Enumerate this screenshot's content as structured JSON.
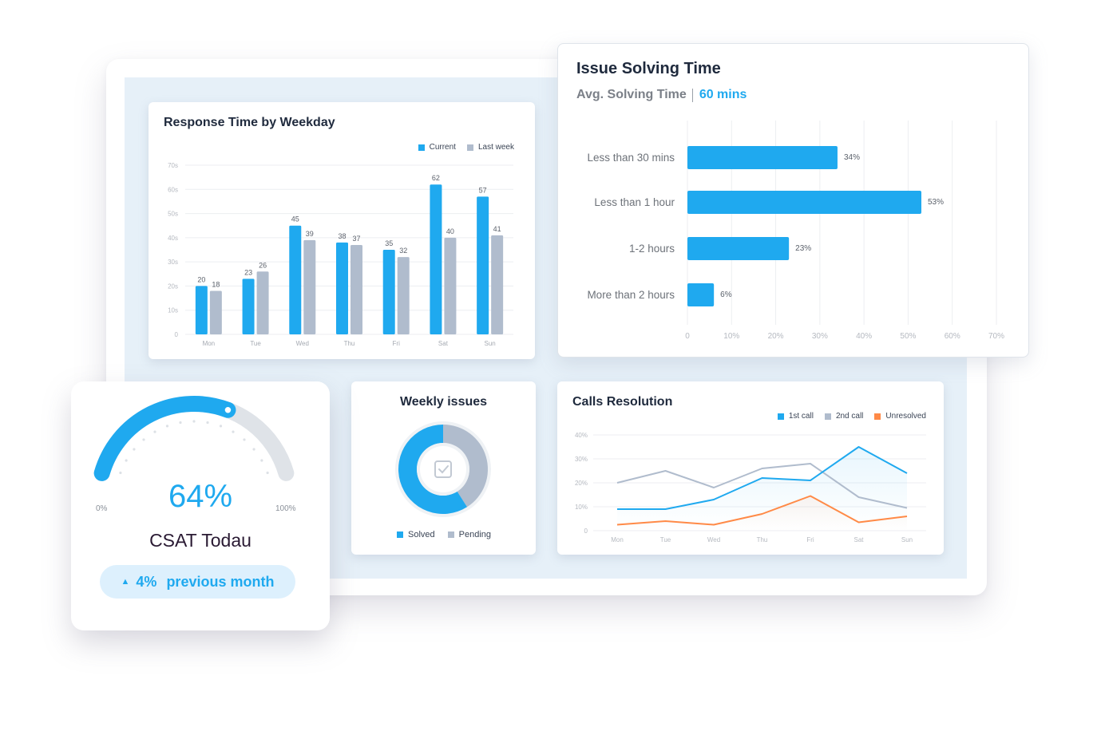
{
  "colors": {
    "primary": "#1fa9ef",
    "secondary": "#b0bccd",
    "accent": "#ff8a47",
    "track": "#dfe3e8",
    "panel_bg": "#e6f0f8"
  },
  "response_card": {
    "title": "Response Time by Weekday",
    "legend": [
      "Current",
      "Last week"
    ]
  },
  "issue_card": {
    "title": "Issue Solving Time",
    "avg_label": "Avg. Solving Time",
    "avg_value": "60 mins"
  },
  "csat_card": {
    "value_label": "64%",
    "value": 64,
    "min_label": "0%",
    "max_label": "100%",
    "title": "CSAT Todau",
    "trend_arrow": "▲",
    "trend_value": "4%",
    "trend_label": "previous month"
  },
  "weekly_card": {
    "title": "Weekly issues",
    "legend": [
      "Solved",
      "Pending"
    ],
    "center_icon": "checkbox-icon"
  },
  "calls_card": {
    "title": "Calls Resolution",
    "legend": [
      "1st call",
      "2nd call",
      "Unresolved"
    ]
  },
  "chart_data": [
    {
      "id": "response",
      "type": "bar",
      "title": "Response Time by Weekday",
      "xlabel": "",
      "ylabel": "",
      "categories": [
        "Mon",
        "Tue",
        "Wed",
        "Thu",
        "Fri",
        "Sat",
        "Sun"
      ],
      "series": [
        {
          "name": "Current",
          "values": [
            20,
            23,
            45,
            38,
            35,
            62,
            57
          ]
        },
        {
          "name": "Last week",
          "values": [
            18,
            26,
            39,
            37,
            32,
            40,
            41
          ]
        }
      ],
      "yticks": [
        "0",
        "10s",
        "20s",
        "30s",
        "40s",
        "50s",
        "60s",
        "70s"
      ],
      "ylim": [
        0,
        70
      ],
      "grid": true,
      "legend_position": "top-right",
      "data_labels": true
    },
    {
      "id": "issue",
      "type": "bar",
      "orientation": "horizontal",
      "title": "Issue Solving Time",
      "categories": [
        "Less than 30 mins",
        "Less than 1 hour",
        "1-2 hours",
        "More than 2 hours"
      ],
      "values": [
        34,
        53,
        23,
        6
      ],
      "value_labels": [
        "34%",
        "53%",
        "23%",
        "6%"
      ],
      "xticks": [
        "0",
        "10%",
        "20%",
        "30%",
        "40%",
        "50%",
        "60%",
        "70%"
      ],
      "xlim": [
        0,
        70
      ],
      "grid": true
    },
    {
      "id": "csat",
      "type": "gauge",
      "title": "CSAT Todau",
      "value": 64,
      "range": [
        0,
        100
      ]
    },
    {
      "id": "weekly",
      "type": "pie",
      "title": "Weekly issues",
      "labels": [
        "Solved",
        "Pending"
      ],
      "values": [
        59,
        41
      ],
      "donut": true,
      "legend_position": "bottom"
    },
    {
      "id": "calls",
      "type": "line",
      "title": "Calls Resolution",
      "categories": [
        "Mon",
        "Tue",
        "Wed",
        "Thu",
        "Fri",
        "Sat",
        "Sun"
      ],
      "series": [
        {
          "name": "1st call",
          "values": [
            9,
            9,
            13,
            22,
            21,
            35,
            24
          ]
        },
        {
          "name": "2nd call",
          "values": [
            20,
            25,
            18,
            26,
            28,
            14,
            9.5
          ]
        },
        {
          "name": "Unresolved",
          "values": [
            2.5,
            4,
            2.5,
            7,
            14.5,
            3.5,
            6
          ]
        }
      ],
      "yticks": [
        "0",
        "10%",
        "20%",
        "30%",
        "40%"
      ],
      "ylim": [
        0,
        40
      ],
      "grid": true,
      "legend_position": "top-right"
    }
  ]
}
